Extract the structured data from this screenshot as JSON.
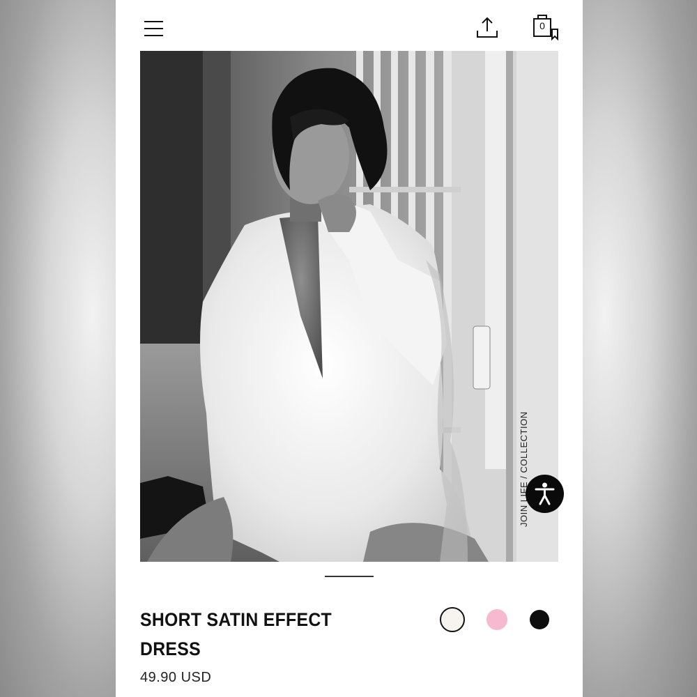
{
  "header": {
    "menu_icon": "hamburger-menu-icon",
    "share_icon": "share-upload-icon",
    "bag_icon": "shopping-bag-icon",
    "bag_count": "0"
  },
  "product_image": {
    "side_label": "JOIN LIFE / COLLECTION",
    "accessibility_icon": "accessibility-person-icon"
  },
  "product": {
    "title": "SHORT SATIN EFFECT DRESS",
    "price": "49.90 USD",
    "colors": [
      "#f7f4ef",
      "#f7b9cf",
      "#0d0d0d"
    ]
  }
}
